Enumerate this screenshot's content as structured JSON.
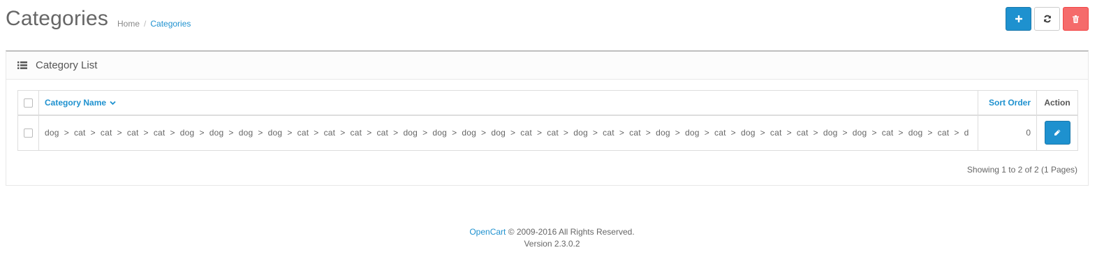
{
  "header": {
    "title": "Categories",
    "breadcrumb": [
      "Home",
      "Categories"
    ],
    "breadcrumb_separator": "/"
  },
  "toolbar": {
    "add_icon": "plus-icon",
    "refresh_icon": "refresh-icon",
    "delete_icon": "trash-icon"
  },
  "panel": {
    "icon": "list-icon",
    "title": "Category List"
  },
  "table": {
    "columns": {
      "name": "Category Name",
      "sort_order": "Sort Order",
      "action": "Action"
    },
    "rows": [
      {
        "name": "dog  >  cat  >  cat  >  cat  >  cat  >  dog  >  dog  >  dog  >  dog  >  cat  >  cat  >  cat  >  cat  >  dog  >  dog  >  dog  >  dog  >  cat  >  cat  >  dog  >  cat  >  cat  >  dog  >  dog  >  cat  >  dog  >  cat  >  cat  >  dog  >  dog  >  cat  >  dog  >  cat  >  d",
        "sort_order": "0"
      }
    ]
  },
  "pagination": {
    "info": "Showing 1 to 2 of 2 (1 Pages)"
  },
  "footer": {
    "brand": "OpenCart",
    "copyright": " © 2009-2016 All Rights Reserved.",
    "version": "Version 2.3.0.2"
  },
  "colors": {
    "primary": "#1e91cf",
    "danger": "#f56b6b"
  }
}
